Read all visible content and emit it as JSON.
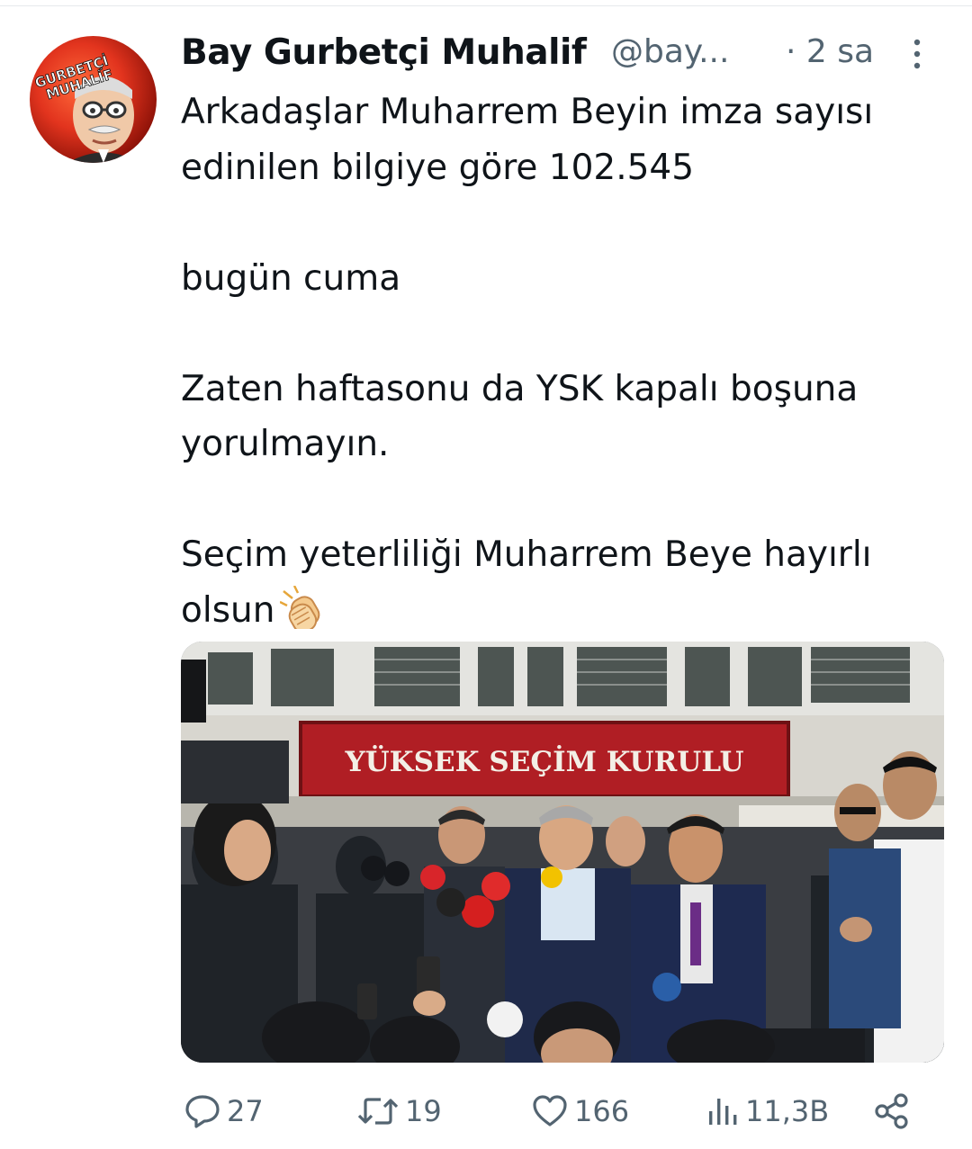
{
  "tweet": {
    "author": {
      "display_name": "Bay Gurbetçi Muhalif",
      "handle": "@bay...",
      "avatar_text_top": "GURBETÇİ",
      "avatar_text_bottom": "MUHALİF"
    },
    "time": "· 2 sa",
    "lines": [
      "Arkadaşlar Muharrem Beyin imza sayısı edinilen bilgiye göre 102.545",
      "bugün cuma",
      "Zaten haftasonu da YSK kapalı boşuna yorulmayın.",
      "Seçim yeterliliği Muharrem Beye hayırlı olsun"
    ],
    "media": {
      "sign_text": "YÜKSEK SEÇİM KURULU"
    },
    "stats": {
      "replies": "27",
      "retweets": "19",
      "likes": "166",
      "views": "11,3B"
    }
  },
  "icons": {
    "more": "more-vertical-icon",
    "reply": "reply-bubble-icon",
    "retweet": "retweet-icon",
    "like": "heart-icon",
    "views": "views-bar-chart-icon",
    "share": "share-icon",
    "emoji": "clapping-hands-emoji"
  },
  "colors": {
    "text": "#0f1419",
    "secondary": "#536471",
    "sign_red": "#c8202a"
  }
}
